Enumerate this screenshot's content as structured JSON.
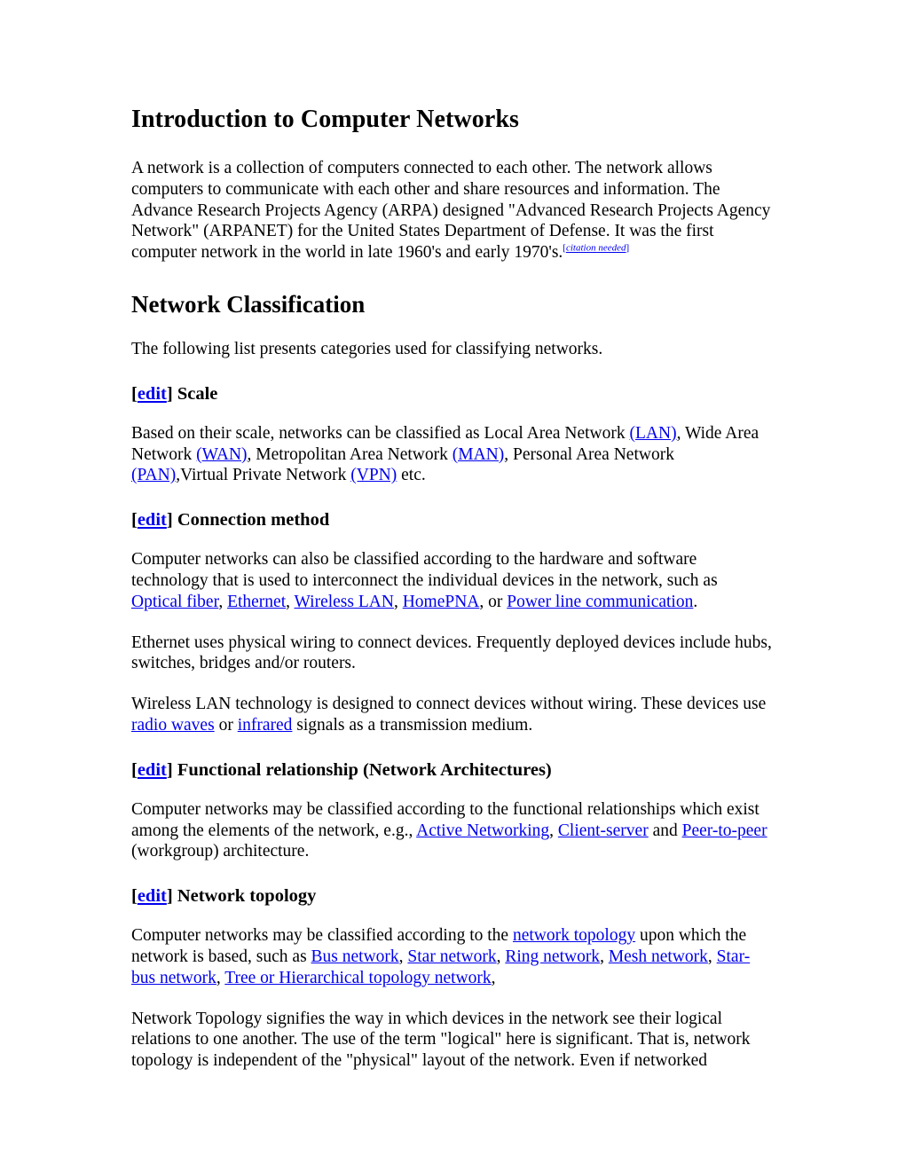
{
  "document": {
    "title": "Introduction to Computer Networks",
    "intro_paragraph": {
      "text": "A network is a collection of computers connected to each other. The network allows computers to communicate with each other and share resources and information. The Advance Research Projects Agency (ARPA) designed \"Advanced Research Projects Agency Network\" (ARPANET) for the United States Department of Defense. It was the first computer network in the world in late 1960's and early 1970's.",
      "citation_label": "citation needed",
      "citation_open_bracket": "[",
      "citation_close_bracket": "]"
    },
    "section": {
      "heading": "Network Classification",
      "lead_paragraph": "The following list presents categories used for classifying networks."
    },
    "edit_label": "edit",
    "bracket_open": "[",
    "bracket_close": "]",
    "subsections": [
      {
        "heading": "Scale",
        "paragraphs": [
          {
            "segments": [
              {
                "type": "text",
                "value": "Based on their scale, networks can be classified as Local Area Network "
              },
              {
                "type": "link",
                "value": "(LAN)"
              },
              {
                "type": "text",
                "value": ", Wide Area Network "
              },
              {
                "type": "link",
                "value": "(WAN)"
              },
              {
                "type": "text",
                "value": ", Metropolitan Area Network "
              },
              {
                "type": "link",
                "value": "(MAN)"
              },
              {
                "type": "text",
                "value": ", Personal Area Network "
              },
              {
                "type": "link",
                "value": "(PAN)"
              },
              {
                "type": "text",
                "value": ",Virtual Private Network "
              },
              {
                "type": "link",
                "value": "(VPN)"
              },
              {
                "type": "text",
                "value": " etc."
              }
            ]
          }
        ]
      },
      {
        "heading": "Connection method",
        "paragraphs": [
          {
            "segments": [
              {
                "type": "text",
                "value": "Computer networks can also be classified according to the hardware and software technology that is used to interconnect the individual devices in the network, such as "
              },
              {
                "type": "link",
                "value": "Optical fiber"
              },
              {
                "type": "text",
                "value": ", "
              },
              {
                "type": "link",
                "value": "Ethernet"
              },
              {
                "type": "text",
                "value": ", "
              },
              {
                "type": "link",
                "value": "Wireless LAN"
              },
              {
                "type": "text",
                "value": ", "
              },
              {
                "type": "link",
                "value": "HomePNA"
              },
              {
                "type": "text",
                "value": ", or "
              },
              {
                "type": "link",
                "value": "Power line communication"
              },
              {
                "type": "text",
                "value": "."
              }
            ]
          },
          {
            "segments": [
              {
                "type": "text",
                "value": "Ethernet uses physical wiring to connect devices. Frequently deployed devices include hubs, switches, bridges and/or routers."
              }
            ]
          },
          {
            "segments": [
              {
                "type": "text",
                "value": "Wireless LAN technology is designed to connect devices without wiring. These devices use "
              },
              {
                "type": "link",
                "value": "radio waves"
              },
              {
                "type": "text",
                "value": " or "
              },
              {
                "type": "link",
                "value": "infrared"
              },
              {
                "type": "text",
                "value": " signals as a transmission medium."
              }
            ]
          }
        ]
      },
      {
        "heading": "Functional relationship (Network Architectures)",
        "paragraphs": [
          {
            "segments": [
              {
                "type": "text",
                "value": "Computer networks may be classified according to the functional relationships which exist among the elements of the network, e.g., "
              },
              {
                "type": "link",
                "value": "Active Networking"
              },
              {
                "type": "text",
                "value": ", "
              },
              {
                "type": "link",
                "value": "Client-server"
              },
              {
                "type": "text",
                "value": " and "
              },
              {
                "type": "link",
                "value": "Peer-to-peer"
              },
              {
                "type": "text",
                "value": " (workgroup) architecture."
              }
            ]
          }
        ]
      },
      {
        "heading": "Network topology",
        "paragraphs": [
          {
            "segments": [
              {
                "type": "text",
                "value": "Computer networks may be classified according to the "
              },
              {
                "type": "link",
                "value": "network topology"
              },
              {
                "type": "text",
                "value": " upon which the network is based, such as "
              },
              {
                "type": "link",
                "value": "Bus network"
              },
              {
                "type": "text",
                "value": ", "
              },
              {
                "type": "link",
                "value": "Star network"
              },
              {
                "type": "text",
                "value": ", "
              },
              {
                "type": "link",
                "value": "Ring network"
              },
              {
                "type": "text",
                "value": ", "
              },
              {
                "type": "link",
                "value": "Mesh network"
              },
              {
                "type": "text",
                "value": ", "
              },
              {
                "type": "link",
                "value": "Star-bus network"
              },
              {
                "type": "text",
                "value": ", "
              },
              {
                "type": "link",
                "value": "Tree or Hierarchical topology network"
              },
              {
                "type": "text",
                "value": ","
              }
            ]
          },
          {
            "segments": [
              {
                "type": "text",
                "value": "Network Topology signifies the way in which devices in the network see their logical relations to one another. The use of the term \"logical\" here is significant. That is, network topology is independent of the \"physical\" layout of the network. Even if networked"
              }
            ]
          }
        ]
      }
    ]
  },
  "colors": {
    "link": "#0000EE",
    "text": "#000000",
    "background": "#ffffff"
  }
}
